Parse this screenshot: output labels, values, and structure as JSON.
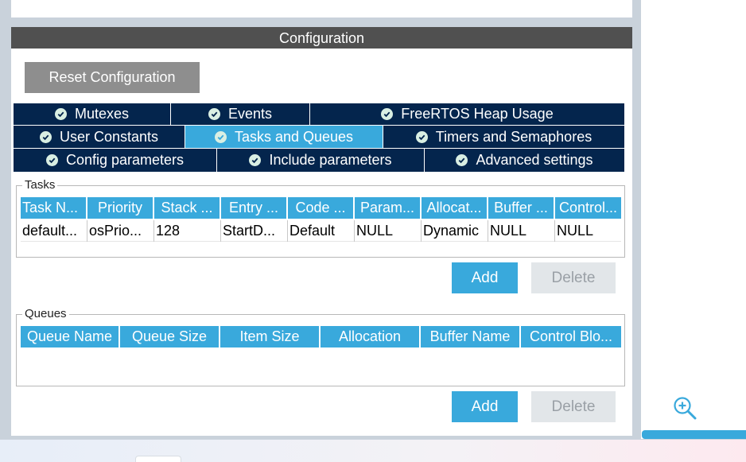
{
  "config": {
    "title": "Configuration",
    "reset_label": "Reset Configuration"
  },
  "tabs": {
    "row1": [
      {
        "label": "Mutexes"
      },
      {
        "label": "Events"
      },
      {
        "label": "FreeRTOS Heap Usage"
      }
    ],
    "row2": [
      {
        "label": "User Constants"
      },
      {
        "label": "Tasks and Queues",
        "active": true
      },
      {
        "label": "Timers and Semaphores"
      }
    ],
    "row3": [
      {
        "label": "Config parameters"
      },
      {
        "label": "Include parameters"
      },
      {
        "label": "Advanced settings"
      }
    ]
  },
  "tasks": {
    "title": "Tasks",
    "columns": [
      "Task N...",
      "Priority",
      "Stack ...",
      "Entry ...",
      "Code ...",
      "Param...",
      "Allocat...",
      "Buffer ...",
      "Control..."
    ],
    "rows": [
      [
        "default...",
        "osPrio...",
        "128",
        "StartD...",
        "Default",
        "NULL",
        "Dynamic",
        "NULL",
        "NULL"
      ]
    ],
    "add_label": "Add",
    "delete_label": "Delete"
  },
  "queues": {
    "title": "Queues",
    "columns": [
      "Queue Name",
      "Queue Size",
      "Item Size",
      "Allocation",
      "Buffer Name",
      "Control Blo..."
    ],
    "add_label": "Add",
    "delete_label": "Delete"
  },
  "icons": {
    "tab_status": "check-circle-icon",
    "zoom": "zoom-in-icon"
  },
  "colors": {
    "tab_bg": "#04254d",
    "accent": "#39a9dc",
    "header_bg": "#505050",
    "reset_bg": "#8e8e8e"
  }
}
